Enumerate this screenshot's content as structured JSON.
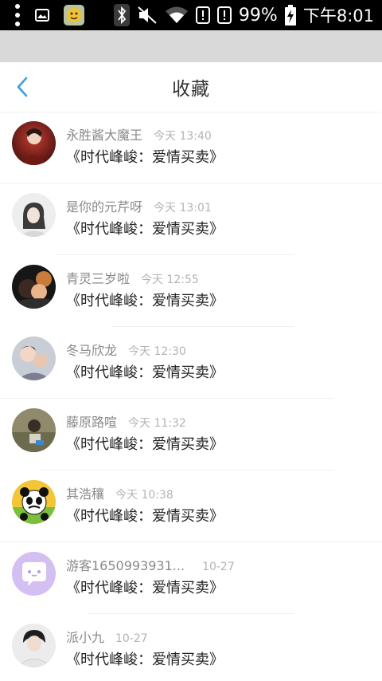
{
  "status_bar": {
    "battery": "99%",
    "time": "下午8:01",
    "icons": [
      "menu-dots-icon",
      "image-notification-icon",
      "app-notification-icon",
      "bluetooth-icon",
      "mute-icon",
      "wifi-icon",
      "alert-icon",
      "alert-icon",
      "battery-charging-icon"
    ]
  },
  "header": {
    "title": "收藏",
    "back_icon": "chevron-left-icon"
  },
  "colors": {
    "accent": "#3aa0e6",
    "name": "#8a8a8a",
    "time": "#b4b4b4",
    "title": "#333333",
    "band": "#d9d9d9"
  },
  "favorites": [
    {
      "user": "永胜酱大魔王",
      "time": "今天 13:40",
      "book": "《时代峰峻：爱情买卖》"
    },
    {
      "user": "是你的元芹呀",
      "time": "今天 13:01",
      "book": "《时代峰峻：爱情买卖》"
    },
    {
      "user": "青灵三岁啦",
      "time": "今天 12:55",
      "book": "《时代峰峻：爱情买卖》"
    },
    {
      "user": "冬马欣龙",
      "time": "今天 12:30",
      "book": "《时代峰峻：爱情买卖》"
    },
    {
      "user": "藤原路喧",
      "time": "今天 11:32",
      "book": "《时代峰峻：爱情买卖》"
    },
    {
      "user": "其浩穰",
      "time": "今天 10:38",
      "book": "《时代峰峻：爱情买卖》"
    },
    {
      "user": "游客1650993931...",
      "time": "10-27",
      "book": "《时代峰峻：爱情买卖》"
    },
    {
      "user": "派小九",
      "time": "10-27",
      "book": "《时代峰峻：爱情买卖》"
    }
  ]
}
